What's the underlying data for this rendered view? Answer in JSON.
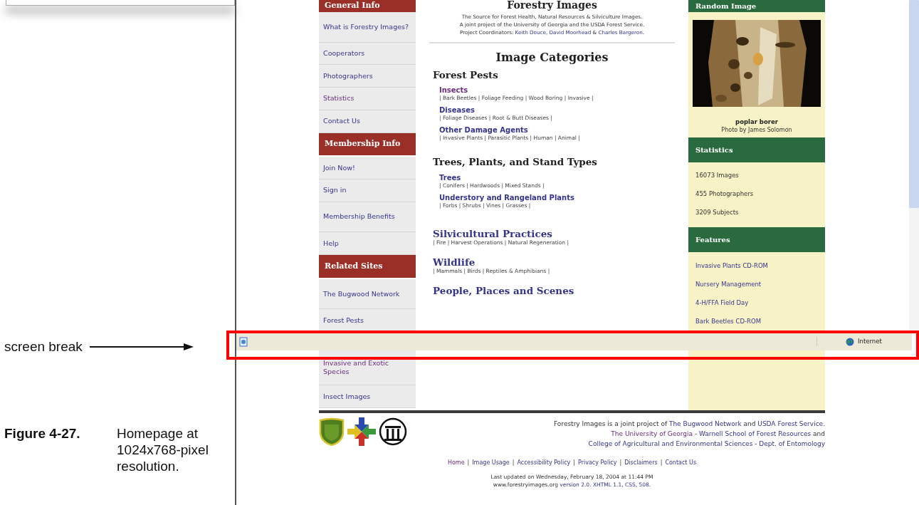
{
  "document": {
    "annotation": "screen break",
    "figure_label": "Figure 4-27.",
    "figure_text": "Homepage at 1024x768-pixel resolution."
  },
  "site": {
    "nav": [
      {
        "kind": "header",
        "label": "General Info"
      },
      {
        "kind": "link",
        "label": "What is Forestry Images?",
        "visited": false
      },
      {
        "kind": "link",
        "label": "Cooperators",
        "visited": false
      },
      {
        "kind": "link",
        "label": "Photographers",
        "visited": false
      },
      {
        "kind": "link",
        "label": "Statistics",
        "visited": true
      },
      {
        "kind": "link",
        "label": "Contact Us",
        "visited": false
      },
      {
        "kind": "header",
        "label": "Membership Info"
      },
      {
        "kind": "link",
        "label": "Join Now!",
        "visited": false
      },
      {
        "kind": "link",
        "label": "Sign in",
        "visited": false
      },
      {
        "kind": "link",
        "label": "Membership Benefits",
        "visited": false
      },
      {
        "kind": "link",
        "label": "Help",
        "visited": false
      },
      {
        "kind": "header",
        "label": "Related Sites"
      },
      {
        "kind": "link",
        "label": "The Bugwood Network",
        "visited": false
      },
      {
        "kind": "link",
        "label": "Forest Pests",
        "visited": false
      }
    ],
    "nav_below": [
      {
        "kind": "link",
        "label": "Invasive and Exotic Species",
        "visited": true
      },
      {
        "kind": "link",
        "label": "Insect Images",
        "visited": false
      }
    ],
    "title": "Forestry Images",
    "tagline": [
      [
        {
          "kind": "text",
          "text": "The Source for Forest Health, Natural Resources & Silviculture Images."
        }
      ],
      [
        {
          "kind": "text",
          "text": "A joint project of the University of Georgia and the USDA Forest Service."
        }
      ],
      [
        {
          "kind": "text",
          "text": "Project Coordinators: "
        },
        {
          "kind": "link",
          "text": "Keith Douce",
          "visited": false
        },
        {
          "kind": "text",
          "text": ", "
        },
        {
          "kind": "link",
          "text": "David Moorhead",
          "visited": false
        },
        {
          "kind": "text",
          "text": " & "
        },
        {
          "kind": "link",
          "text": "Charles Bargeron",
          "visited": false
        },
        {
          "kind": "text",
          "text": "."
        }
      ]
    ],
    "categories_title": "Image Categories",
    "sections": [
      {
        "kind": "group",
        "heading": "Forest Pests",
        "items": [
          {
            "label": "Insects",
            "visited": true,
            "subs": "| Bark Beetles | Foliage Feeding | Wood Boring | Invasive |"
          },
          {
            "label": "Diseases",
            "visited": false,
            "subs": "| Foliage Diseases | Root & Butt Diseases |"
          },
          {
            "label": "Other Damage Agents",
            "visited": false,
            "subs": "| Invasive Plants | Parasitic Plants | Human | Animal |"
          }
        ]
      },
      {
        "kind": "group",
        "heading": "Trees, Plants, and Stand Types",
        "items": [
          {
            "label": "Trees",
            "visited": false,
            "subs": "| Conifers | Hardwoods | Mixed Stands |"
          },
          {
            "label": "Understory and Rangeland Plants",
            "visited": false,
            "subs": "| Forbs | Shrubs | Vines | Grasses |"
          }
        ]
      },
      {
        "kind": "link",
        "heading": "Silvicultural Practices",
        "subs": "| Fire | Harvest Operations | Natural Regeneration |"
      },
      {
        "kind": "link",
        "heading": "Wildlife",
        "subs": "| Mammals | Birds | Reptiles & Amphibians |"
      },
      {
        "kind": "link",
        "heading": "People, Places and Scenes"
      }
    ],
    "random_image": {
      "header": "Random Image",
      "caption": "poplar borer",
      "credit": "Photo by James Solomon"
    },
    "statistics": {
      "header": "Statistics",
      "lines": [
        "16073 Images",
        "455 Photographers",
        "3209 Subjects"
      ]
    },
    "features": {
      "header": "Features",
      "links": [
        "Invasive Plants CD-ROM",
        "Nursery Management",
        "4-H/FFA Field Day",
        "Bark Beetles CD-ROM"
      ]
    },
    "status_bar": {
      "zone": "Internet"
    },
    "footer": {
      "lines": [
        [
          {
            "kind": "text",
            "text": "Forestry Images is a joint project of "
          },
          {
            "kind": "link",
            "text": "The Bugwood Network",
            "visited": false
          },
          {
            "kind": "text",
            "text": " and "
          },
          {
            "kind": "link",
            "text": "USDA Forest Service.",
            "visited": false
          }
        ],
        [
          {
            "kind": "link",
            "text": "The University of Georgia",
            "visited": true
          },
          {
            "kind": "text",
            "text": " - "
          },
          {
            "kind": "link",
            "text": "Warnell School of Forest Resources",
            "visited": false
          },
          {
            "kind": "text",
            "text": " and"
          }
        ],
        [
          {
            "kind": "link",
            "text": "College of Agricultural and Environmental Sciences - Dept. of Entomology",
            "visited": false
          }
        ]
      ],
      "separator": "|",
      "links": [
        {
          "label": "Home",
          "visited": true
        },
        {
          "label": "Image Usage",
          "visited": false
        },
        {
          "label": "Accessibility Policy",
          "visited": false
        },
        {
          "label": "Privacy Policy",
          "visited": false
        },
        {
          "label": "Disclaimers",
          "visited": false
        },
        {
          "label": "Contact Us",
          "visited": false
        }
      ],
      "updated": [
        [
          {
            "kind": "text",
            "text": "Last updated on Wednesday, February 18, 2004 at 11:44 PM"
          }
        ],
        [
          {
            "kind": "text",
            "text": "www.forestryimages.org "
          },
          {
            "kind": "link",
            "text": "version 2.0. XHTML 1.1, CSS, 508.",
            "visited": false
          }
        ]
      ]
    }
  }
}
